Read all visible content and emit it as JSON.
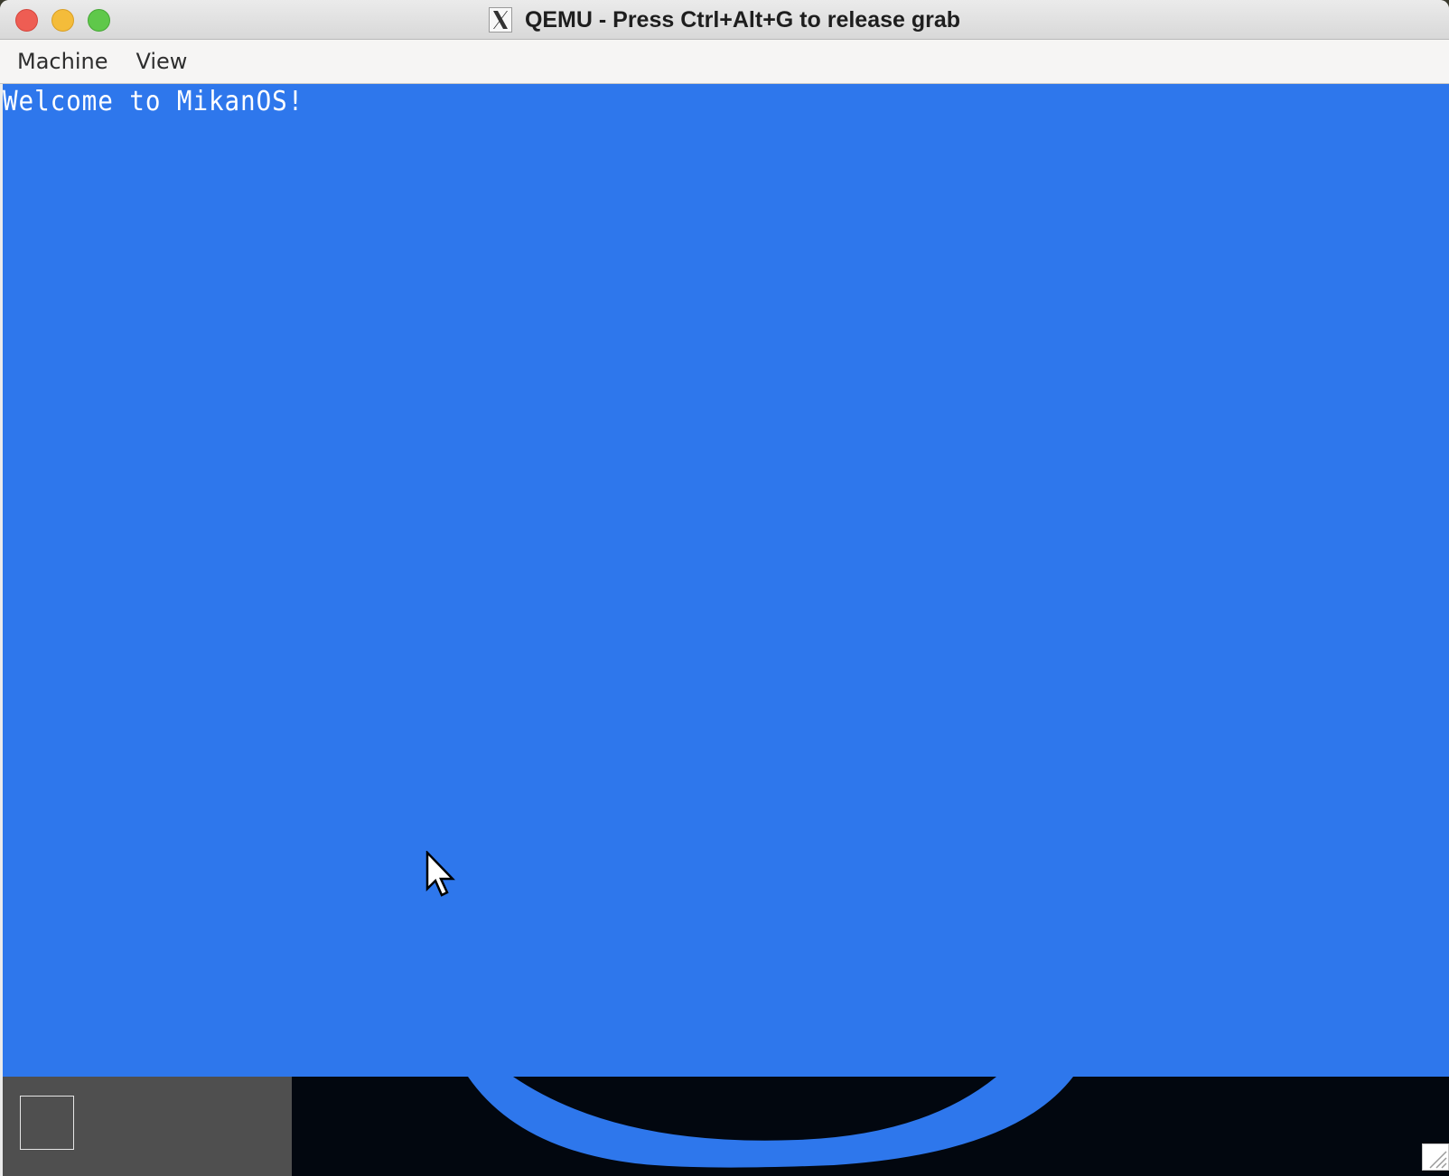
{
  "window": {
    "title": "QEMU - Press Ctrl+Alt+G to release grab",
    "app_icon": "x11-icon"
  },
  "menubar": {
    "items": [
      {
        "label": "Machine"
      },
      {
        "label": "View"
      }
    ]
  },
  "screen": {
    "background_color": "#2e77ec",
    "console_text": "Welcome to MikanOS!",
    "text_color": "#ffffff",
    "cursor_icon": "mouse-pointer-icon"
  },
  "taskbar": {
    "background_color": "#4f4f4f",
    "button_icon": "square-outline-icon"
  }
}
